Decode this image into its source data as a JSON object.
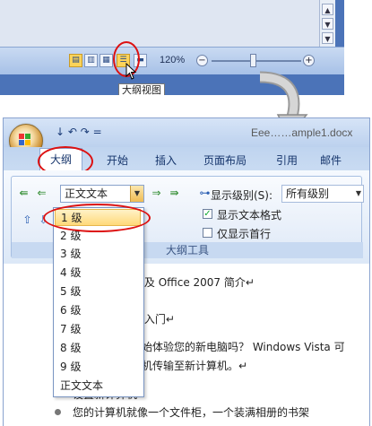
{
  "top": {
    "zoom_label": "120%",
    "tooltip": "大纲视图",
    "vscroll_up": "▲",
    "vscroll_down": "▼",
    "zoom_minus": "−",
    "zoom_plus": "+"
  },
  "bottom": {
    "title": "Eee……ample1.docx",
    "qat": "↓ ↶ ↷ =",
    "tabs": {
      "outline": "大纲",
      "home": "开始",
      "insert": "插入",
      "page_layout": "页面布局",
      "references": "引用",
      "mailings": "邮件"
    },
    "ribbon": {
      "level_combo": "正文文本",
      "show_level_label": "显示级别(S):",
      "show_level_value": "所有级别",
      "show_text_format": "显示文本格式",
      "show_first_line": "仅显示首行",
      "group_label": "大纲工具"
    },
    "dropdown": [
      "1 级",
      "2 级",
      "3 级",
      "4 级",
      "5 级",
      "6 级",
      "7 级",
      "8 级",
      "9 级",
      "正文文本"
    ],
    "doc_lines": [
      "ta 及 Office 2007 简介↵",
      "ta 入门↵",
      "始体验您的新电脑吗？ Windows Vista 可",
      "机传输至新计算机。↵",
      "设置新计算机↵",
      "您的计算机就像一个文件柜，一个装满相册的书架"
    ]
  },
  "colors": {
    "accent": "#d11111",
    "ribbon_blue": "#c7d9f1",
    "selected": "#ffd97a"
  }
}
